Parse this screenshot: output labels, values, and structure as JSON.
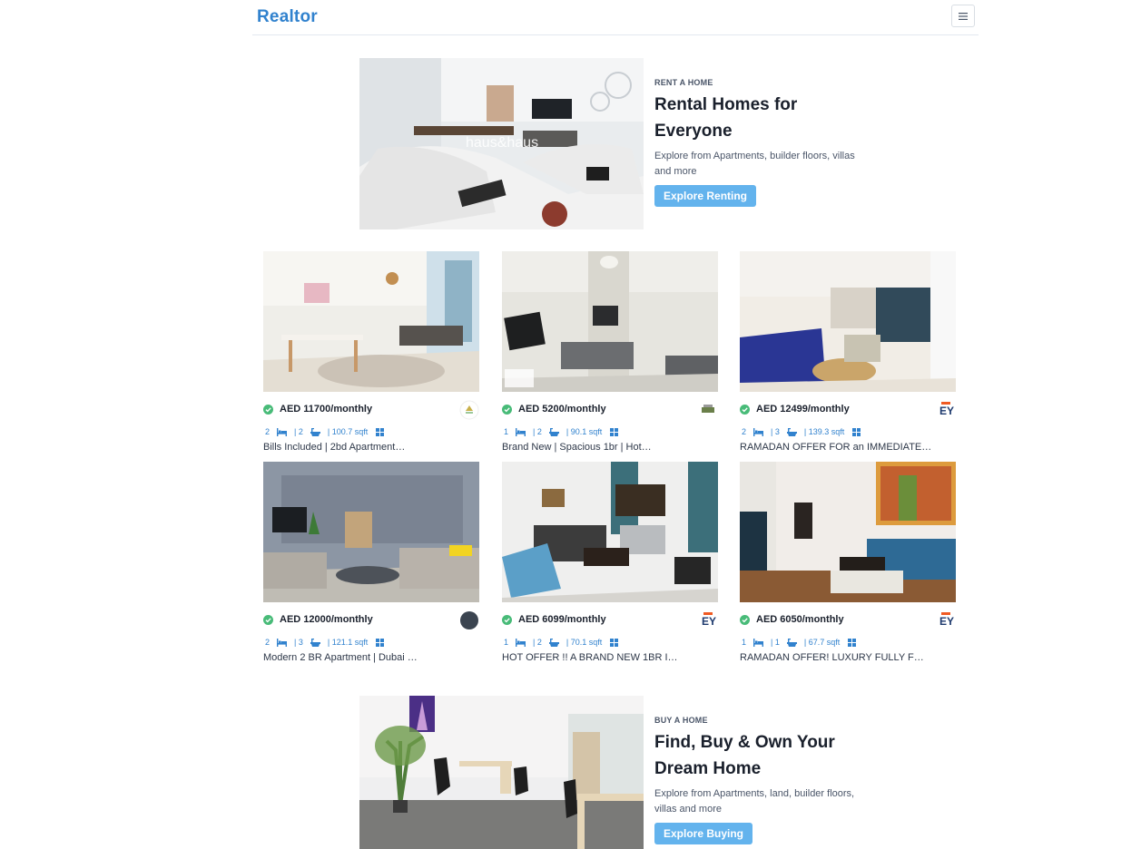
{
  "nav": {
    "brand": "Realtor",
    "menu_icon": "hamburger-icon"
  },
  "rent_banner": {
    "eyebrow": "RENT A HOME",
    "title": "Rental Homes for Everyone",
    "description": "Explore from Apartments, builder floors, villas and more",
    "button": "Explore Renting",
    "photo_watermark": "haus&haus"
  },
  "listings": [
    {
      "price": "AED 11700/monthly",
      "rooms": "2",
      "baths": "| 2",
      "area": "| 100.7 sqft",
      "title": "Bills Included | 2bd Apartment…"
    },
    {
      "price": "AED 5200/monthly",
      "rooms": "1",
      "baths": "| 2",
      "area": "| 90.1 sqft",
      "title": "Brand New | Spacious 1br | Hot…"
    },
    {
      "price": "AED 12499/monthly",
      "rooms": "2",
      "baths": "| 3",
      "area": "| 139.3 sqft",
      "title": "RAMADAN OFFER FOR an IMMEDIATE…"
    },
    {
      "price": "AED 12000/monthly",
      "rooms": "2",
      "baths": "| 3",
      "area": "| 121.1 sqft",
      "title": "Modern 2 BR Apartment | Dubai …"
    },
    {
      "price": "AED 6099/monthly",
      "rooms": "1",
      "baths": "| 2",
      "area": "| 70.1 sqft",
      "title": "HOT OFFER !! A BRAND NEW 1BR I…"
    },
    {
      "price": "AED 6050/monthly",
      "rooms": "1",
      "baths": "| 1",
      "area": "| 67.7 sqft",
      "title": "RAMADAN OFFER! LUXURY FULLY F…"
    }
  ],
  "buy_banner": {
    "eyebrow": "BUY A HOME",
    "title": "Find, Buy & Own Your Dream Home",
    "description": "Explore from Apartments, land, builder floors, villas and more",
    "button": "Explore Buying"
  },
  "colors": {
    "brand": "#3182ce",
    "button": "#63b3ed",
    "verified": "#48bb78",
    "meta": "#3182ce"
  },
  "icons": {
    "verified": "check-circle-icon",
    "bed": "bed-icon",
    "bath": "bath-icon",
    "area": "grid-icon"
  }
}
